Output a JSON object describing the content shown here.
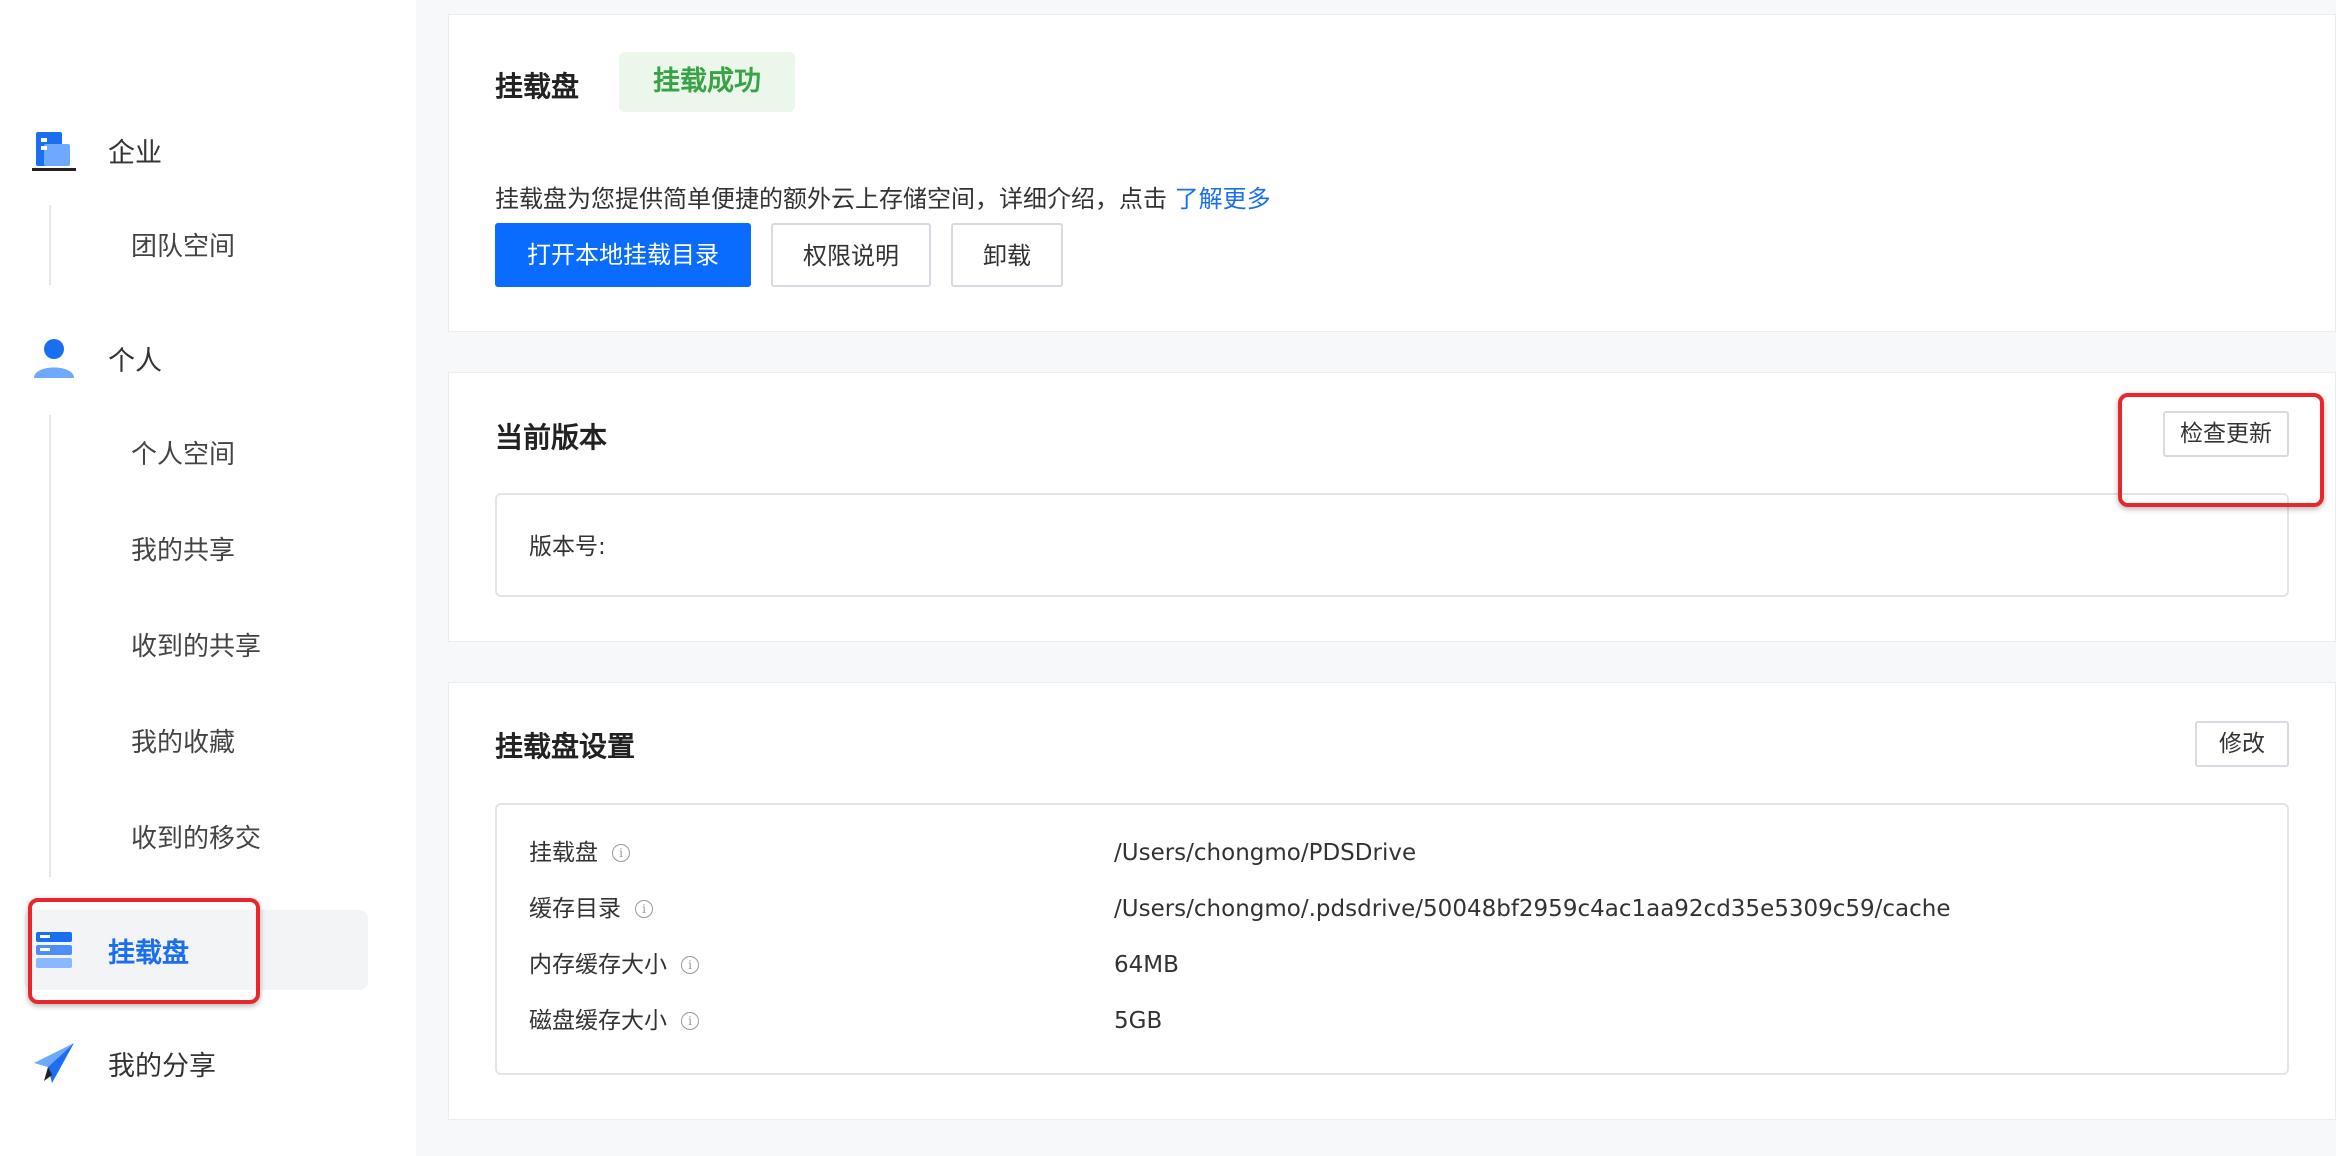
{
  "sidebar": {
    "enterprise": {
      "label": "企业",
      "icon": "building-icon",
      "items": [
        "团队空间"
      ]
    },
    "personal": {
      "label": "个人",
      "icon": "user-icon",
      "items": [
        "个人空间",
        "我的共享",
        "收到的共享",
        "我的收藏",
        "收到的移交"
      ]
    },
    "mount": {
      "label": "挂载盘",
      "icon": "mount-drive-icon",
      "active": true
    },
    "my_share": {
      "label": "我的分享",
      "icon": "paper-plane-icon"
    }
  },
  "mount_card": {
    "title": "挂载盘",
    "status_badge": "挂载成功",
    "description": "挂载盘为您提供简单便捷的额外云上存储空间，详细介绍，点击",
    "learn_more": "了解更多",
    "buttons": {
      "open_dir": "打开本地挂载目录",
      "permissions": "权限说明",
      "unmount": "卸载"
    }
  },
  "version_card": {
    "title": "当前版本",
    "check_update": "检查更新",
    "version_label": "版本号:"
  },
  "settings_card": {
    "title": "挂载盘设置",
    "edit": "修改",
    "rows": [
      {
        "key": "挂载盘",
        "value": "/Users/chongmo/PDSDrive"
      },
      {
        "key": "缓存目录",
        "value": "/Users/chongmo/.pdsdrive/50048bf2959c4ac1aa92cd35e5309c59/cache"
      },
      {
        "key": "内存缓存大小",
        "value": "64MB"
      },
      {
        "key": "磁盘缓存大小",
        "value": "5GB"
      }
    ]
  },
  "colors": {
    "primary": "#0a6cff",
    "success_text": "#3aa246",
    "success_bg": "#eaf7ea",
    "highlight": "#e8262b"
  }
}
